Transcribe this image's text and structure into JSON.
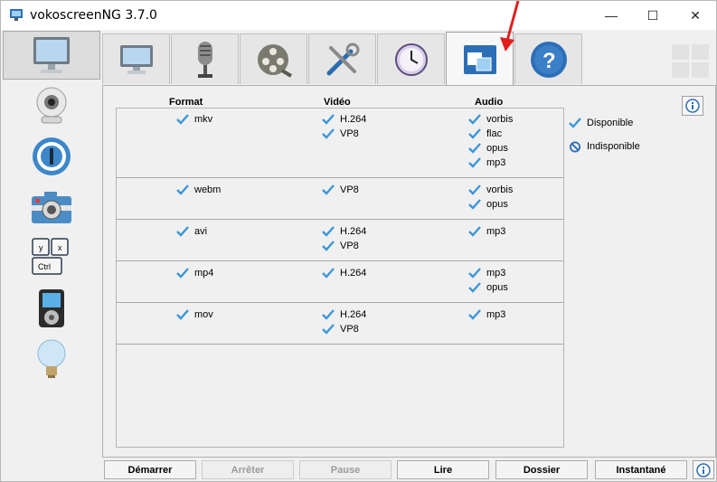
{
  "window": {
    "title": "vokoscreenNG 3.7.0",
    "minimize": "—",
    "maximize": "☐",
    "close": "✕"
  },
  "sidebar": {
    "items": [
      {
        "name": "monitor"
      },
      {
        "name": "webcam"
      },
      {
        "name": "magnifier"
      },
      {
        "name": "camera"
      },
      {
        "name": "shortcuts"
      },
      {
        "name": "player"
      },
      {
        "name": "lightbulb"
      }
    ]
  },
  "shortcut_keys": {
    "y": "y",
    "x": "x",
    "ctrl": "Ctrl"
  },
  "tabs": [
    "screencast",
    "audio",
    "video",
    "tools",
    "timer",
    "available-formats",
    "help"
  ],
  "table": {
    "headers": {
      "format": "Format",
      "video": "Vidéo",
      "audio": "Audio"
    },
    "rows": [
      {
        "format": "mkv",
        "video": [
          "H.264",
          "VP8"
        ],
        "audio": [
          "vorbis",
          "flac",
          "opus",
          "mp3"
        ]
      },
      {
        "format": "webm",
        "video": [
          "VP8"
        ],
        "audio": [
          "vorbis",
          "opus"
        ]
      },
      {
        "format": "avi",
        "video": [
          "H.264",
          "VP8"
        ],
        "audio": [
          "mp3"
        ]
      },
      {
        "format": "mp4",
        "video": [
          "H.264"
        ],
        "audio": [
          "mp3",
          "opus"
        ]
      },
      {
        "format": "mov",
        "video": [
          "H.264",
          "VP8"
        ],
        "audio": [
          "mp3"
        ]
      }
    ]
  },
  "legend": {
    "available": "Disponible",
    "unavailable": "Indisponible"
  },
  "buttons": {
    "start": "Démarrer",
    "stop": "Arrêter",
    "pause": "Pause",
    "play": "Lire",
    "folder": "Dossier",
    "snapshot": "Instantané"
  },
  "colors": {
    "check": "#3b96d8",
    "accent_red": "#e02020",
    "blue_icon": "#2d6fb6"
  }
}
